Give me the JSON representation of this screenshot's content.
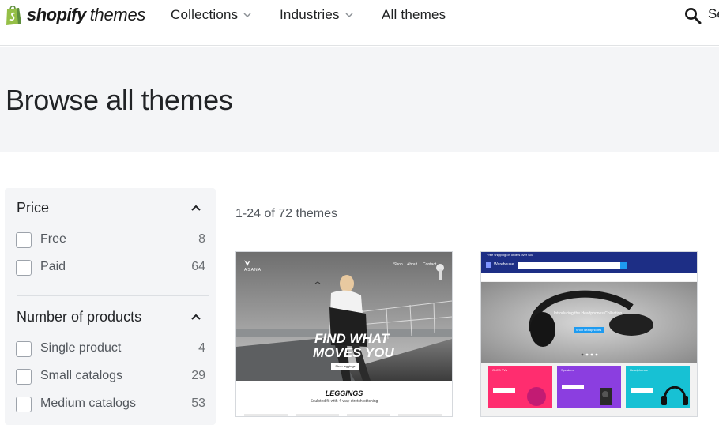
{
  "brand": {
    "name_bold": "shopify",
    "name_light": "themes",
    "bag_color": "#95bf47"
  },
  "nav": {
    "items": [
      {
        "label": "Collections",
        "has_dropdown": true
      },
      {
        "label": "Industries",
        "has_dropdown": true
      },
      {
        "label": "All themes",
        "has_dropdown": false
      }
    ],
    "search_label": "Se"
  },
  "hero": {
    "title": "Browse all themes"
  },
  "filters": {
    "price": {
      "title": "Price",
      "options": [
        {
          "label": "Free",
          "count": "8"
        },
        {
          "label": "Paid",
          "count": "64"
        }
      ]
    },
    "products": {
      "title": "Number of products",
      "options": [
        {
          "label": "Single product",
          "count": "4"
        },
        {
          "label": "Small catalogs",
          "count": "29"
        },
        {
          "label": "Medium catalogs",
          "count": "53"
        }
      ]
    }
  },
  "results": {
    "count_text": "1-24 of 72 themes"
  },
  "themes": [
    {
      "brand": "ASANA",
      "nav_links": [
        "Shop",
        "About",
        "Contact"
      ],
      "headline_1": "FIND WHAT",
      "headline_2": "MOVES YOU",
      "cta": "Shop leggings",
      "section_title": "LEGGINGS",
      "section_sub": "Sculpted fit with 4-way stretch stitching"
    },
    {
      "top_banner": "Free shipping on orders over $50",
      "brand": "Warehouse",
      "hero_text": "Introducing the Headphones Collection",
      "hero_cta": "Shop headphones",
      "tiles": [
        {
          "title": "OLED TVs",
          "color": "#ff2d6f"
        },
        {
          "title": "Speakers",
          "color": "#8b3ee0"
        },
        {
          "title": "Headphones",
          "color": "#17c1d4"
        }
      ],
      "accent": "#1d2e85"
    }
  ]
}
